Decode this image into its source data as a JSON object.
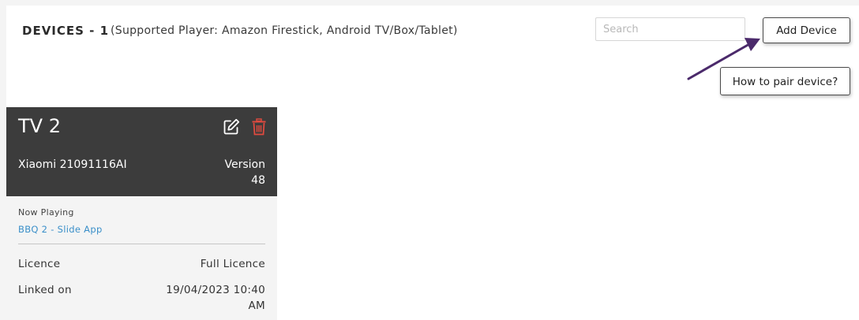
{
  "header": {
    "title": "DEVICES - 1",
    "subtitle": "(Supported Player: Amazon Firestick, Android TV/Box/Tablet)"
  },
  "search": {
    "placeholder": "Search",
    "value": ""
  },
  "actions": {
    "add_device_label": "Add Device",
    "pair_help_label": "How to pair device?"
  },
  "colors": {
    "card_header_bg": "#3c3c3c",
    "delete_icon": "#e04a3f",
    "link": "#3a8fc9",
    "arrow": "#4b2a6b"
  },
  "devices": [
    {
      "name": "TV 2",
      "model": "Xiaomi 21091116AI",
      "version_label": "Version",
      "version_value": "48",
      "now_playing_label": "Now Playing",
      "now_playing_value": "BBQ 2 - Slide App",
      "licence_label": "Licence",
      "licence_value": "Full Licence",
      "linked_label": "Linked on",
      "linked_value_line1": "19/04/2023 10:40",
      "linked_value_line2": "AM",
      "icons": [
        "edit-icon",
        "trash-icon"
      ]
    }
  ]
}
